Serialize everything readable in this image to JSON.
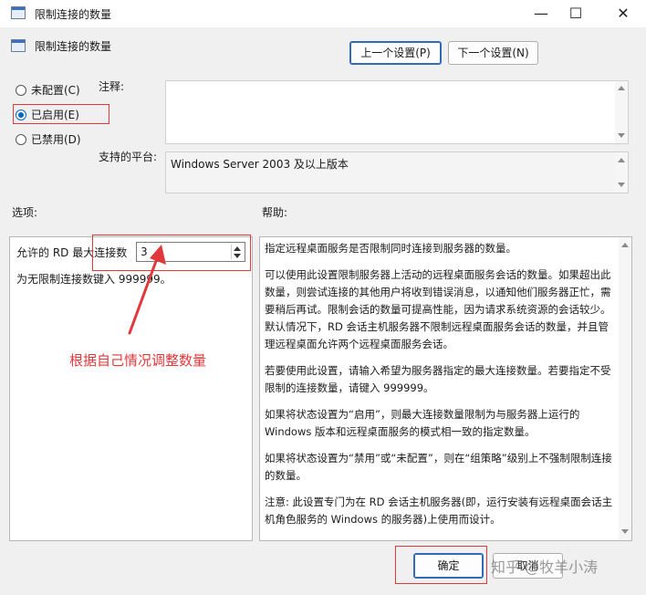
{
  "window": {
    "title": "限制连接的数量",
    "controls": {
      "minimize": "—",
      "maximize": "☐",
      "close": "✕"
    }
  },
  "header": {
    "policy_name": "限制连接的数量",
    "prev_button": "上一个设置(P)",
    "next_button": "下一个设置(N)"
  },
  "state": {
    "options": [
      {
        "label": "未配置(C)",
        "checked": false
      },
      {
        "label": "已启用(E)",
        "checked": true
      },
      {
        "label": "已禁用(D)",
        "checked": false
      }
    ]
  },
  "comment": {
    "label": "注释:",
    "value": ""
  },
  "platform": {
    "label": "支持的平台:",
    "value": "Windows Server 2003 及以上版本"
  },
  "options_section": {
    "label": "选项:",
    "max_connections_label": "允许的 RD 最大连接数",
    "max_connections_value": "3",
    "hint": "为无限制连接数键入 999999。"
  },
  "help_section": {
    "label": "帮助:",
    "paragraphs": [
      "指定远程桌面服务是否限制同时连接到服务器的数量。",
      "可以使用此设置限制服务器上活动的远程桌面服务会话的数量。如果超出此数量，则尝试连接的其他用户将收到错误消息，以通知他们服务器正忙，需要稍后再试。限制会话的数量可提高性能，因为请求系统资源的会话较少。默认情况下，RD 会话主机服务器不限制远程桌面服务会话的数量，并且管理远程桌面允许两个远程桌面服务会话。",
      "若要使用此设置，请输入希望为服务器指定的最大连接数量。若要指定不受限制的连接数量，请键入 999999。",
      "如果将状态设置为“启用”，则最大连接数量限制为与服务器上运行的 Windows 版本和远程桌面服务的模式相一致的指定数量。",
      "如果将状态设置为“禁用”或“未配置”，则在“组策略”级别上不强制限制连接的数量。",
      "注意: 此设置专门为在 RD 会话主机服务器(即，运行安装有远程桌面会话主机角色服务的 Windows 的服务器)上使用而设计。"
    ]
  },
  "footer": {
    "ok_button": "确定",
    "cancel_button": "取消",
    "watermark": "知乎 @牧羊小涛"
  },
  "annotation": {
    "text": "根据自己情况调整数量",
    "color": "#e0383b"
  }
}
